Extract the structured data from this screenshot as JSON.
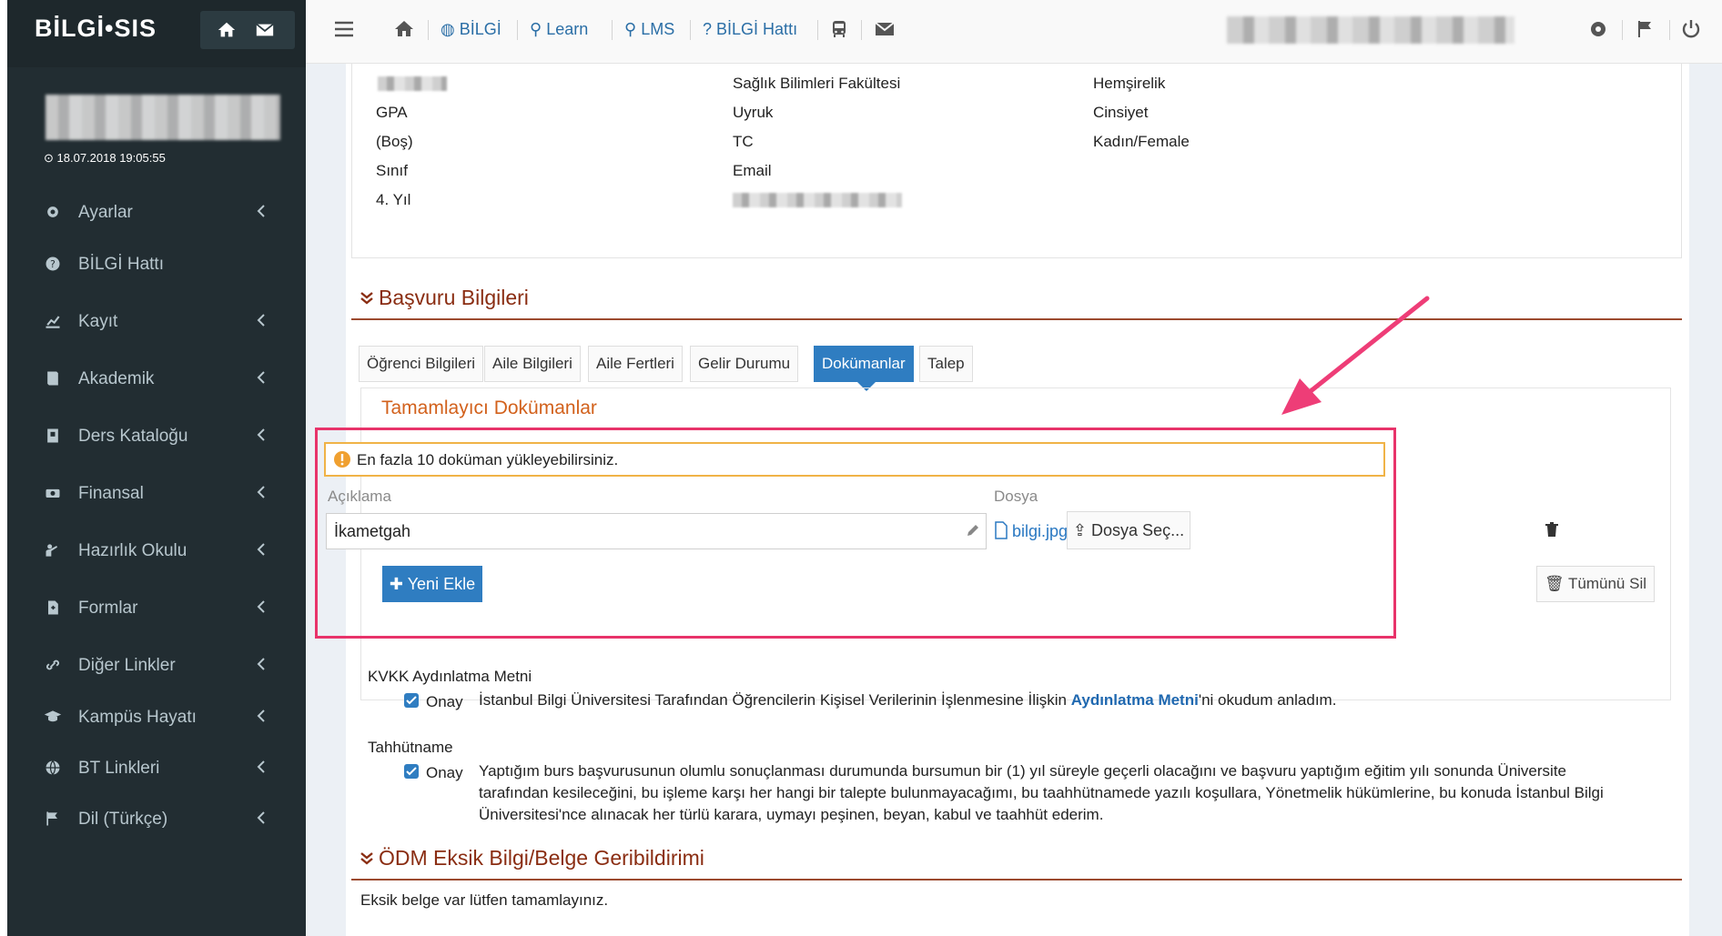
{
  "brand": {
    "name": "BİLGİ•SIS"
  },
  "user": {
    "last_login": "18.07.2018 19:05:55"
  },
  "sidebar": {
    "items": [
      {
        "label": "Ayarlar"
      },
      {
        "label": "BİLGİ Hattı"
      },
      {
        "label": "Kayıt"
      },
      {
        "label": "Akademik"
      },
      {
        "label": "Ders Kataloğu"
      },
      {
        "label": "Finansal"
      },
      {
        "label": "Hazırlık Okulu"
      },
      {
        "label": "Formlar"
      },
      {
        "label": "Diğer Linkler"
      },
      {
        "label": "Kampüs Hayatı"
      },
      {
        "label": "BT Linkleri"
      },
      {
        "label": "Dil (Türkçe)"
      }
    ]
  },
  "topnav": {
    "links": [
      {
        "label": "BİLGİ"
      },
      {
        "label": "Learn"
      },
      {
        "label": "LMS"
      },
      {
        "label": "BİLGİ Hattı"
      }
    ]
  },
  "student_info": {
    "faculty": "Sağlık Bilimleri Fakültesi",
    "program": "Hemşirelik",
    "gpa_label": "GPA",
    "gpa_value": "(Boş)",
    "nationality_label": "Uyruk",
    "tc_label": "TC",
    "gender_label": "Cinsiyet",
    "gender_value": "Kadın/Female",
    "class_label": "Sınıf",
    "class_value": "4. Yıl",
    "email_label": "Email"
  },
  "application": {
    "section_title": "Başvuru Bilgileri",
    "tabs": [
      {
        "label": "Öğrenci Bilgileri"
      },
      {
        "label": "Aile Bilgileri"
      },
      {
        "label": "Aile Fertleri"
      },
      {
        "label": "Gelir Durumu"
      },
      {
        "label": "Dokümanlar"
      },
      {
        "label": "Talep"
      }
    ],
    "active_tab": "Dokümanlar"
  },
  "documents": {
    "title": "Tamamlayıcı Dokümanlar",
    "warning": "En fazla 10 doküman yükleyebilirsiniz.",
    "description_label": "Açıklama",
    "file_label": "Dosya",
    "description_value": "İkametgah",
    "file_name": "bilgi.jpg",
    "choose_file": "Dosya Seç...",
    "add_new": "Yeni Ekle",
    "delete_all": "Tümünü Sil"
  },
  "kvkk": {
    "title": "KVKK Aydınlatma Metni",
    "approve": "Onay",
    "text_before": "İstanbul Bilgi Üniversitesi Tarafından Öğrencilerin Kişisel Verilerinin İşlenmesine İlişkin",
    "link": "Aydınlatma Metni",
    "text_after": "'ni okudum anladım."
  },
  "pledge": {
    "title": "Tahhütname",
    "approve": "Onay",
    "line1": "Yaptığım burs başvurusunun olumlu sonuçlanması durumunda bursumun bir (1) yıl süreyle geçerli olacağını ve başvuru yaptığım eğitim yılı sonunda Üniversite",
    "line2": "tarafından kesileceğini, bu işleme karşı her hangi bir talepte bulunmayacağımı, bu taahhütnamede yazılı koşullara, Yönetmelik hükümlerine, bu konuda İstanbul Bilgi",
    "line3": "Üniversitesi'nce alınacak her türlü karara, uymayı peşinen, beyan, kabul ve taahhüt ederim."
  },
  "odm": {
    "section_title": "ÖDM Eksik Bilgi/Belge Geribildirimi",
    "message": "Eksik belge var lütfen tamamlayınız."
  },
  "colors": {
    "sidebar_bg": "#222d32",
    "accent_blue": "#2f7dc1",
    "section_title": "#8a2d12",
    "docs_title": "#d2611c",
    "highlight": "#e8336a",
    "warning_border": "#f0b347"
  }
}
